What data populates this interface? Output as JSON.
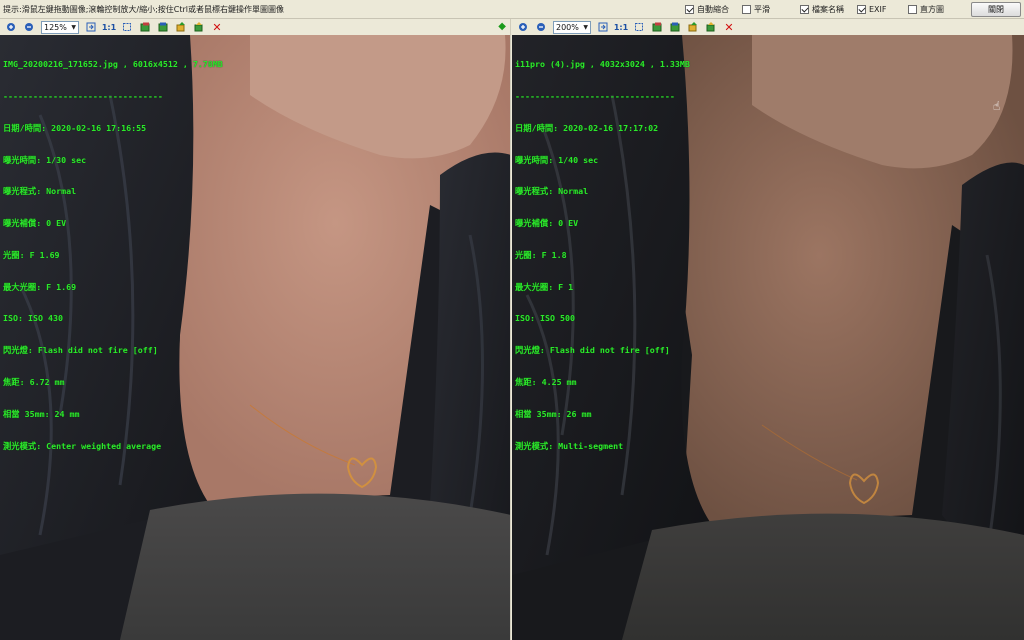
{
  "topbar": {
    "hint": "提示:滑鼠左鍵拖動圖像;滾輪控制放大/縮小;按住Ctrl或者鼠標右鍵操作單圖圖像",
    "options": [
      {
        "label": "自動縮合",
        "checked": true
      },
      {
        "label": "平滑",
        "checked": false
      },
      {
        "label": "檔案名稱",
        "checked": true
      },
      {
        "label": "EXIF",
        "checked": true
      },
      {
        "label": "直方圖",
        "checked": false
      }
    ],
    "close_label": "關閉"
  },
  "left": {
    "zoom": "125%",
    "one_to_one": "1:1",
    "file_line": "IMG_20200216_171652.jpg , 6016x4512 , 7.78MB",
    "separator": "--------------------------------",
    "exif": [
      "日期/時間: 2020-02-16 17:16:55",
      "曝光時間: 1/30 sec",
      "曝光程式: Normal",
      "曝光補償: 0 EV",
      "光圈: F 1.69",
      "最大光圈: F 1.69",
      "ISO: ISO 430",
      "閃光燈: Flash did not fire [off]",
      "焦距: 6.72 mm",
      "相當 35mm: 24 mm",
      "測光模式: Center weighted average"
    ]
  },
  "right": {
    "zoom": "200%",
    "one_to_one": "1:1",
    "file_line": "i11pro (4).jpg , 4032x3024 , 1.33MB",
    "separator": "--------------------------------",
    "exif": [
      "日期/時間: 2020-02-16 17:17:02",
      "曝光時間: 1/40 sec",
      "曝光程式: Normal",
      "曝光補償: 0 EV",
      "光圈: F 1.8",
      "最大光圈: F 1",
      "ISO: ISO 500",
      "閃光燈: Flash did not fire [off]",
      "焦距: 4.25 mm",
      "相當 35mm: 26 mm",
      "測光模式: Multi-segment"
    ]
  },
  "icons": [
    "zoom-in-icon",
    "zoom-out-icon",
    "fit-window-icon",
    "prev-image-icon",
    "next-image-icon",
    "rotate-left-icon",
    "rotate-right-icon",
    "delete-icon",
    "sync-arrow-icon",
    "hand-cursor-icon"
  ]
}
